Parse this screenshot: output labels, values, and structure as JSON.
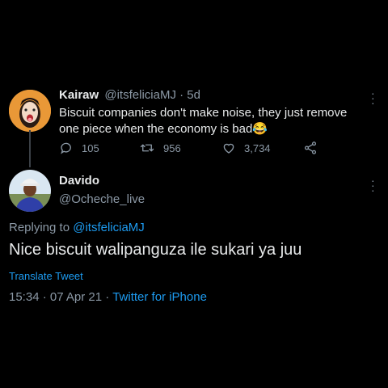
{
  "tweet": {
    "display_name": "Kairaw",
    "handle": "@itsfeliciaMJ",
    "separator": "·",
    "age": "5d",
    "text": "Biscuit companies don't make noise, they just remove one piece when the economy is bad😂",
    "actions": {
      "replies": "105",
      "retweets": "956",
      "likes": "3,734"
    }
  },
  "reply": {
    "display_name": "Davido",
    "handle": "@Ocheche_live",
    "replying_prefix": "Replying to",
    "replying_handle": "@itsfeliciaMJ",
    "text": "Nice biscuit walipanguza ile sukari ya juu",
    "translate_label": "Translate Tweet",
    "time": "15:34",
    "date": "07 Apr 21",
    "source": "Twitter for iPhone"
  },
  "icons": {
    "reply": "speech-bubble-icon",
    "retweet": "retweet-icon",
    "like": "heart-icon",
    "share": "share-icon",
    "more": "more-vertical-icon"
  },
  "colors": {
    "background": "#000000",
    "accent": "#1d9bf0",
    "muted": "#8b98a5"
  }
}
